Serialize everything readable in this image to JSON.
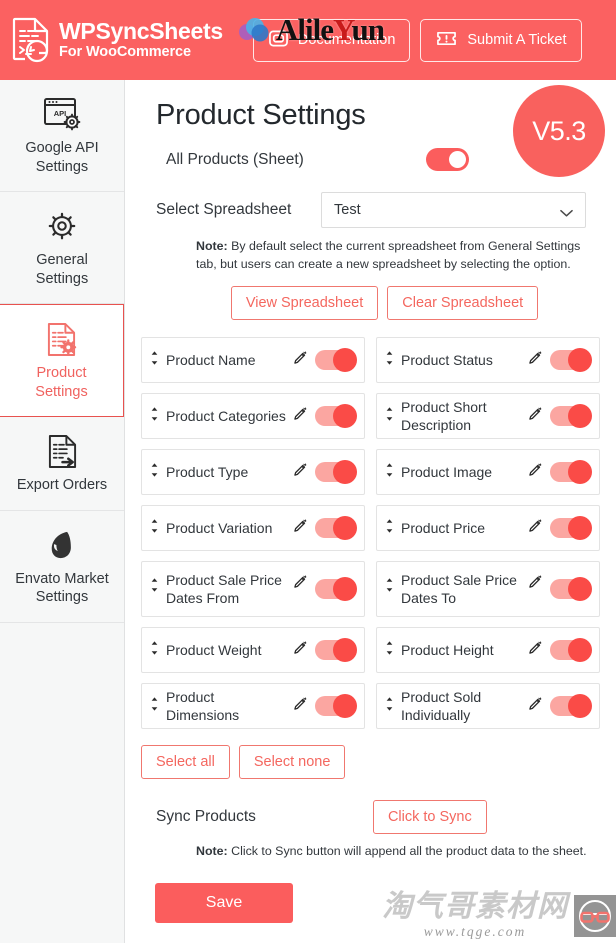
{
  "header": {
    "brand_title": "WPSyncSheets",
    "brand_subtitle": "For WooCommerce",
    "doc_button": "Documentation",
    "ticket_button": "Submit A Ticket",
    "accent_color": "#fb6161"
  },
  "watermarks": {
    "header_text_a": "Alile",
    "header_text_b": "Y",
    "header_text_c": "un",
    "bottom_cn": "淘气哥素材网",
    "bottom_url": "www.tqge.com"
  },
  "sidebar": {
    "items": [
      {
        "label": "Google API\nSettings",
        "label_line1": "Google API",
        "label_line2": "Settings",
        "icon": "api-window-gear-icon",
        "active": false
      },
      {
        "label": "General Settings",
        "label_line1": "General",
        "label_line2": "Settings",
        "icon": "gear-icon",
        "active": false
      },
      {
        "label": "Product Settings",
        "label_line1": "Product",
        "label_line2": "Settings",
        "icon": "document-gear-icon",
        "active": true
      },
      {
        "label": "Export Orders",
        "label_line1": "Export Orders",
        "label_line2": "",
        "icon": "document-export-icon",
        "active": false
      },
      {
        "label": "Envato Market Settings",
        "label_line1": "Envato Market",
        "label_line2": "Settings",
        "icon": "envato-leaf-icon",
        "active": false
      }
    ]
  },
  "main": {
    "page_title": "Product Settings",
    "version_badge": "V5.3",
    "all_products_label": "All Products (Sheet)",
    "all_products_enabled": true,
    "select_spreadsheet_label": "Select Spreadsheet",
    "spreadsheet_value": "Test",
    "note_bold": "Note:",
    "note_text": " By default select the current spreadsheet from General Settings tab, but users can create a new spreadsheet by selecting the option.",
    "view_spreadsheet_button": "View Spreadsheet",
    "clear_spreadsheet_button": "Clear Spreadsheet",
    "fields": [
      {
        "label": "Product Name",
        "enabled": true,
        "tall": false
      },
      {
        "label": "Product Status",
        "enabled": true,
        "tall": false
      },
      {
        "label": "Product Categories",
        "enabled": true,
        "tall": false
      },
      {
        "label": "Product Short Description",
        "enabled": true,
        "tall": false
      },
      {
        "label": "Product Type",
        "enabled": true,
        "tall": false
      },
      {
        "label": "Product Image",
        "enabled": true,
        "tall": false
      },
      {
        "label": "Product Variation",
        "enabled": true,
        "tall": false
      },
      {
        "label": "Product Price",
        "enabled": true,
        "tall": false
      },
      {
        "label": "Product Sale Price Dates From",
        "enabled": true,
        "tall": true
      },
      {
        "label": "Product Sale Price Dates To",
        "enabled": true,
        "tall": true
      },
      {
        "label": "Product Weight",
        "enabled": true,
        "tall": false
      },
      {
        "label": "Product Height",
        "enabled": true,
        "tall": false
      },
      {
        "label": "Product Dimensions",
        "enabled": true,
        "tall": false
      },
      {
        "label": "Product Sold Individually",
        "enabled": true,
        "tall": false
      }
    ],
    "select_all_button": "Select all",
    "select_none_button": "Select none",
    "sync_products_label": "Sync Products",
    "click_to_sync_button": "Click to Sync",
    "note2_bold": "Note:",
    "note2_text": " Click to Sync button will append all the product data to the sheet.",
    "save_button": "Save"
  }
}
